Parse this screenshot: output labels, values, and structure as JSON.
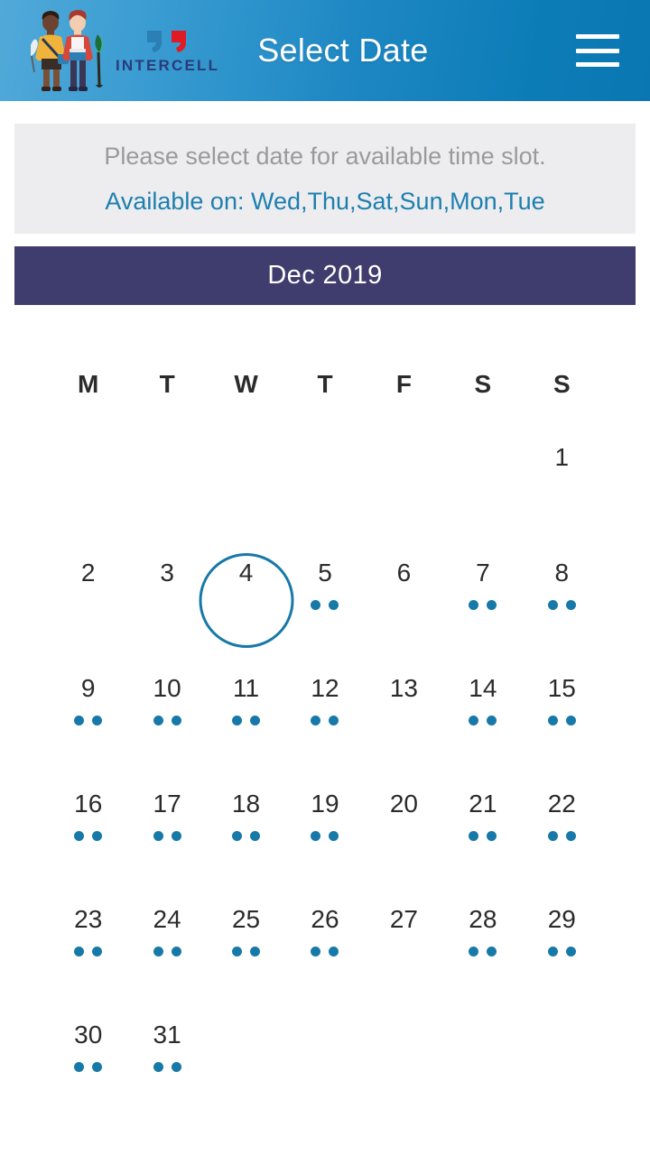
{
  "header": {
    "title": "Select Date",
    "brand_name": "INTERCELL",
    "menu_icon": "hamburger-menu-icon",
    "gradient_from": "#51a9d9",
    "gradient_to": "#0a77b2"
  },
  "banner": {
    "instruction": "Please select date for available time slot.",
    "availability": "Available on: Wed,Thu,Sat,Sun,Mon,Tue",
    "background": "#ededf0",
    "instruction_color": "#9a9a9a",
    "availability_color": "#1d7fae"
  },
  "month_bar": {
    "label": "Dec 2019",
    "background": "#3e3d6d",
    "text_color": "#ffffff"
  },
  "calendar": {
    "weekday_headers": [
      "M",
      "T",
      "W",
      "T",
      "F",
      "S",
      "S"
    ],
    "accent_color": "#1779a8",
    "selected_day": "4",
    "weeks": [
      [
        {
          "day": "",
          "dots": 0,
          "today": false,
          "empty": true
        },
        {
          "day": "",
          "dots": 0,
          "today": false,
          "empty": true
        },
        {
          "day": "",
          "dots": 0,
          "today": false,
          "empty": true
        },
        {
          "day": "",
          "dots": 0,
          "today": false,
          "empty": true
        },
        {
          "day": "",
          "dots": 0,
          "today": false,
          "empty": true
        },
        {
          "day": "",
          "dots": 0,
          "today": false,
          "empty": true
        },
        {
          "day": "1",
          "dots": 0,
          "today": false,
          "empty": false
        }
      ],
      [
        {
          "day": "2",
          "dots": 0,
          "today": false,
          "empty": false
        },
        {
          "day": "3",
          "dots": 0,
          "today": false,
          "empty": false
        },
        {
          "day": "4",
          "dots": 0,
          "today": true,
          "empty": false
        },
        {
          "day": "5",
          "dots": 2,
          "today": false,
          "empty": false
        },
        {
          "day": "6",
          "dots": 0,
          "today": false,
          "empty": false
        },
        {
          "day": "7",
          "dots": 2,
          "today": false,
          "empty": false
        },
        {
          "day": "8",
          "dots": 2,
          "today": false,
          "empty": false
        }
      ],
      [
        {
          "day": "9",
          "dots": 2,
          "today": false,
          "empty": false
        },
        {
          "day": "10",
          "dots": 2,
          "today": false,
          "empty": false
        },
        {
          "day": "11",
          "dots": 2,
          "today": false,
          "empty": false
        },
        {
          "day": "12",
          "dots": 2,
          "today": false,
          "empty": false
        },
        {
          "day": "13",
          "dots": 0,
          "today": false,
          "empty": false
        },
        {
          "day": "14",
          "dots": 2,
          "today": false,
          "empty": false
        },
        {
          "day": "15",
          "dots": 2,
          "today": false,
          "empty": false
        }
      ],
      [
        {
          "day": "16",
          "dots": 2,
          "today": false,
          "empty": false
        },
        {
          "day": "17",
          "dots": 2,
          "today": false,
          "empty": false
        },
        {
          "day": "18",
          "dots": 2,
          "today": false,
          "empty": false
        },
        {
          "day": "19",
          "dots": 2,
          "today": false,
          "empty": false
        },
        {
          "day": "20",
          "dots": 0,
          "today": false,
          "empty": false
        },
        {
          "day": "21",
          "dots": 2,
          "today": false,
          "empty": false
        },
        {
          "day": "22",
          "dots": 2,
          "today": false,
          "empty": false
        }
      ],
      [
        {
          "day": "23",
          "dots": 2,
          "today": false,
          "empty": false
        },
        {
          "day": "24",
          "dots": 2,
          "today": false,
          "empty": false
        },
        {
          "day": "25",
          "dots": 2,
          "today": false,
          "empty": false
        },
        {
          "day": "26",
          "dots": 2,
          "today": false,
          "empty": false
        },
        {
          "day": "27",
          "dots": 0,
          "today": false,
          "empty": false
        },
        {
          "day": "28",
          "dots": 2,
          "today": false,
          "empty": false
        },
        {
          "day": "29",
          "dots": 2,
          "today": false,
          "empty": false
        }
      ],
      [
        {
          "day": "30",
          "dots": 2,
          "today": false,
          "empty": false
        },
        {
          "day": "31",
          "dots": 2,
          "today": false,
          "empty": false
        },
        {
          "day": "",
          "dots": 0,
          "today": false,
          "empty": true
        },
        {
          "day": "",
          "dots": 0,
          "today": false,
          "empty": true
        },
        {
          "day": "",
          "dots": 0,
          "today": false,
          "empty": true
        },
        {
          "day": "",
          "dots": 0,
          "today": false,
          "empty": true
        },
        {
          "day": "",
          "dots": 0,
          "today": false,
          "empty": true
        }
      ]
    ]
  }
}
